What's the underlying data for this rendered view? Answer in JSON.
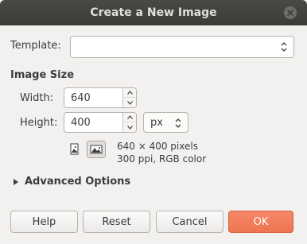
{
  "window": {
    "title": "Create a New Image"
  },
  "template": {
    "label": "Template:",
    "value": ""
  },
  "image_size": {
    "heading": "Image Size",
    "width_label": "Width:",
    "width_value": "640",
    "height_label": "Height:",
    "height_value": "400",
    "unit": "px",
    "info_line1": "640 × 400 pixels",
    "info_line2": "300 ppi, RGB color"
  },
  "advanced": {
    "label": "Advanced Options"
  },
  "buttons": {
    "help": "Help",
    "reset": "Reset",
    "cancel": "Cancel",
    "ok": "OK"
  },
  "colors": {
    "titlebar": "#3c3b37",
    "accent": "#ee7650",
    "background": "#f2f1f0"
  }
}
